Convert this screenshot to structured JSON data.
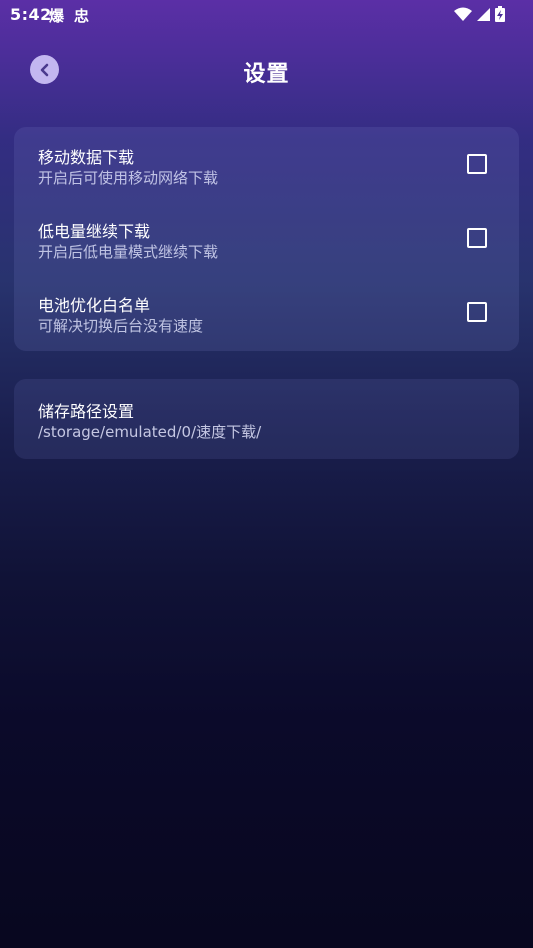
{
  "status_bar": {
    "time": "5:42",
    "notification_icons": [
      "爆",
      "忠"
    ],
    "system_icons": [
      "wifi-icon",
      "signal-icon",
      "battery-charging-icon"
    ]
  },
  "header": {
    "title": "设置",
    "back_icon": "back-arrow-icon"
  },
  "options": [
    {
      "title": "移动数据下载",
      "description": "开启后可使用移动网络下载",
      "checked": false
    },
    {
      "title": "低电量继续下载",
      "description": "开启后低电量模式继续下载",
      "checked": false
    },
    {
      "title": "电池优化白名单",
      "description": "可解决切换后台没有速度",
      "checked": false
    }
  ],
  "storage": {
    "title": "储存路径设置",
    "path": "/storage/emulated/0/速度下载/"
  },
  "colors": {
    "gradient_top": "#5b2fa6",
    "gradient_bottom": "#08071f",
    "back_button": "#c3b7f0",
    "back_arrow": "#4a3a8e"
  }
}
